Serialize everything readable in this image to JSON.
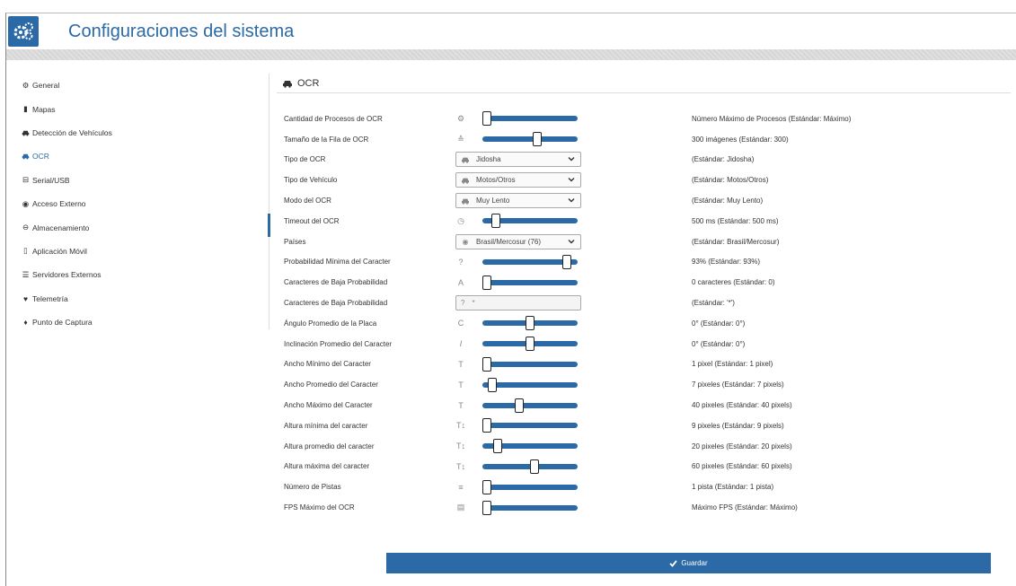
{
  "app": {
    "title": "Configuraciones del sistema"
  },
  "sidebar": {
    "items": [
      {
        "label": "General",
        "icon": "gears-icon"
      },
      {
        "label": "Mapas",
        "icon": "map-icon"
      },
      {
        "label": "Detección de Vehículos",
        "icon": "car-icon"
      },
      {
        "label": "OCR",
        "icon": "car-icon",
        "active": true
      },
      {
        "label": "Serial/USB",
        "icon": "serial-icon"
      },
      {
        "label": "Acceso Externo",
        "icon": "globe-icon"
      },
      {
        "label": "Almacenamiento",
        "icon": "drive-icon"
      },
      {
        "label": "Aplicación Móvil",
        "icon": "mobile-icon"
      },
      {
        "label": "Servidores Externos",
        "icon": "server-icon"
      },
      {
        "label": "Telemetría",
        "icon": "heartbeat-icon"
      },
      {
        "label": "Punto de Captura",
        "icon": "pin-icon"
      }
    ]
  },
  "section": {
    "title": "OCR"
  },
  "settings": [
    {
      "label": "Cantidad de Procesos de OCR",
      "type": "slider",
      "icon": "gears-icon",
      "level": 0.0,
      "value": "Número Máximo de Procesos  (Estándar: Máximo)"
    },
    {
      "label": "Tamaño de la Fila de OCR",
      "type": "slider",
      "icon": "stack-icon",
      "level": 0.58,
      "value": "300 imágenes  (Estándar: 300)"
    },
    {
      "label": "Tipo de OCR",
      "type": "select",
      "icon": "car-icon",
      "selected": "Jidosha",
      "value": "(Estándar: Jidosha)"
    },
    {
      "label": "Tipo de Vehículo",
      "type": "select",
      "icon": "car-icon",
      "selected": "Motos/Otros",
      "value": "(Estándar: Motos/Otros)"
    },
    {
      "label": "Modo del OCR",
      "type": "select",
      "icon": "car-icon",
      "selected": "Muy Lento",
      "value": "(Estándar: Muy Lento)"
    },
    {
      "label": "Timeout del OCR",
      "type": "slider",
      "icon": "clock-icon",
      "level": 0.1,
      "value": "500 ms  (Estándar: 500 ms)"
    },
    {
      "label": "Países",
      "type": "select",
      "icon": "globe-icon",
      "selected": "Brasil/Mercosur (76)",
      "value": "(Estándar: Brasil/Mercosur)"
    },
    {
      "label": "Probabilidad Mínima del Caracter",
      "type": "slider",
      "icon": "question-icon",
      "level": 0.93,
      "value": "93%  (Estándar: 93%)"
    },
    {
      "label": "Caracteres de Baja Probabilidad",
      "type": "slider",
      "icon": "font-icon",
      "level": 0.0,
      "value": "0 caracteres  (Estándar: 0)"
    },
    {
      "label": "Caracteres de Baja Probabilidad",
      "type": "text",
      "icon": "question-icon",
      "text": "*",
      "value": "(Estándar: '*')"
    },
    {
      "label": "Ángulo Promedio de la Placa",
      "type": "slider",
      "icon": "rotate-icon",
      "level": 0.5,
      "value": "0°  (Estándar: 0°)"
    },
    {
      "label": "Inclinación Promedio del Caracter",
      "type": "slider",
      "icon": "italic-icon",
      "level": 0.5,
      "value": "0°  (Estándar: 0°)"
    },
    {
      "label": "Ancho Mínimo del Caracter",
      "type": "slider",
      "icon": "text-width-icon",
      "level": 0.0,
      "value": "1 pixel  (Estándar: 1 pixel)"
    },
    {
      "label": "Ancho Promedio del Caracter",
      "type": "slider",
      "icon": "text-width-icon",
      "level": 0.06,
      "value": "7 pixeles  (Estándar: 7 pixels)"
    },
    {
      "label": "Ancho Máximo del Caracter",
      "type": "slider",
      "icon": "text-width-icon",
      "level": 0.38,
      "value": "40 pixeles  (Estándar: 40 pixels)"
    },
    {
      "label": "Altura mínima del caracter",
      "type": "slider",
      "icon": "text-height-icon",
      "level": 0.0,
      "value": "9 pixeles  (Estándar: 9 pixels)"
    },
    {
      "label": "Altura promedio del caracter",
      "type": "slider",
      "icon": "text-height-icon",
      "level": 0.12,
      "value": "20 pixeles  (Estándar: 20 pixels)"
    },
    {
      "label": "Altura máxima del caracter",
      "type": "slider",
      "icon": "text-height-icon",
      "level": 0.55,
      "value": "60 pixeles  (Estándar: 60 pixels)"
    },
    {
      "label": "Número de Pistas",
      "type": "slider",
      "icon": "lines-icon",
      "level": 0.0,
      "value": "1 pista  (Estándar: 1 pista)"
    },
    {
      "label": "FPS Máximo del OCR",
      "type": "slider",
      "icon": "film-icon",
      "level": 0.0,
      "value": "Máximo FPS  (Estándar: Máximo)"
    }
  ],
  "actions": {
    "save_label": "Guardar"
  },
  "colors": {
    "accent": "#2b6aa6"
  }
}
